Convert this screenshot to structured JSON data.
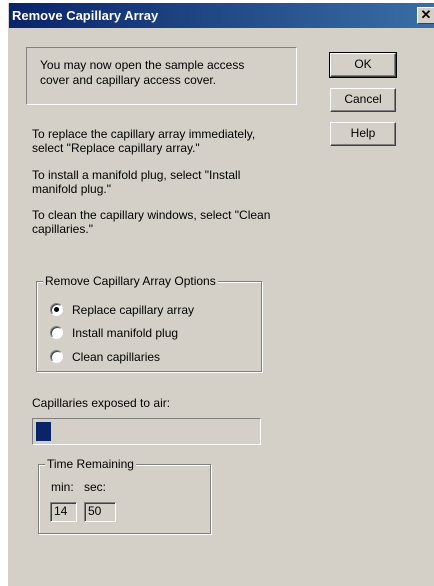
{
  "window": {
    "title": "Remove Capillary Array",
    "close_glyph": "✕"
  },
  "message": {
    "line1": "You may now open the sample access",
    "line2": "cover and capillary access cover."
  },
  "buttons": {
    "ok": "OK",
    "cancel": "Cancel",
    "help": "Help"
  },
  "instructions": {
    "replace_1": "To replace the capillary array immediately,",
    "replace_2": "select \"Replace capillary array.\"",
    "install_1": "To install a manifold plug, select \"Install",
    "install_2": "manifold plug.\"",
    "clean_1": "To clean the capillary windows, select \"Clean",
    "clean_2": "capillaries.\""
  },
  "options": {
    "legend": "Remove Capillary Array Options",
    "items": [
      {
        "label": "Replace capillary array",
        "checked": true
      },
      {
        "label": "Install manifold plug",
        "checked": false
      },
      {
        "label": "Clean capillaries",
        "checked": false
      }
    ]
  },
  "exposure": {
    "label": "Capillaries exposed to air:",
    "progress_fraction": 0.07
  },
  "time": {
    "legend": "Time Remaining",
    "min_label": "min:",
    "sec_label": "sec:",
    "min_value": "14",
    "sec_value": "50"
  },
  "colors": {
    "titlebar_start": "#0a246a",
    "titlebar_end": "#3a6ea5",
    "face": "#d4d0c8",
    "progress": "#0a246a"
  }
}
